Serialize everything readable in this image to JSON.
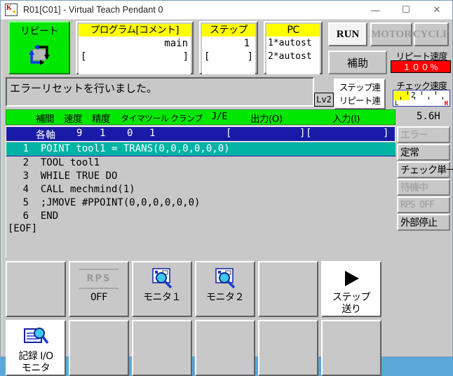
{
  "window": {
    "title": "R01[C01] - Virtual Teach Pendant 0",
    "app_icon": "kawasaki-robot-icon",
    "minimize": "—",
    "maximize": "☐",
    "close": "✕"
  },
  "mode_button": {
    "label": "リピート",
    "icon": "repeat-cycle-icon",
    "color": "#00e800"
  },
  "program_field": {
    "header": "プログラム[コメント]",
    "value": "main",
    "bracket_left": "[",
    "bracket_right": "]"
  },
  "step_field": {
    "header": "ステップ",
    "value": "1",
    "bracket_left": "[",
    "bracket_right": "]"
  },
  "pc_field": {
    "header": "PC",
    "line1": "1*autost",
    "line2": "2*autost"
  },
  "lamps": {
    "run": "RUN",
    "motor": "MOTOR",
    "cycle": "CYCLE"
  },
  "aux_button": {
    "label": "補助"
  },
  "repeat_speed": {
    "label": "リピート速度",
    "value": "１００％",
    "color": "#ff0000"
  },
  "message": {
    "text": "エラーリセットを行いました。",
    "level_badge": "Lv2"
  },
  "step_repeat_button": {
    "line1": "ステップ連",
    "line2": "リピート連"
  },
  "check_speed": {
    "label": "チェック速度",
    "value": "2",
    "min_label": "L",
    "max_label": "H"
  },
  "hz_label": "5.6H",
  "column_header": {
    "items": [
      "補間",
      "速度",
      "精度",
      "タイマ",
      "ツール",
      "クランプ",
      "J/E",
      "出力(O)",
      "入力(I)"
    ]
  },
  "status_row": {
    "axis": "各軸",
    "v1": "9",
    "v2": "1",
    "v3": "0",
    "v4": "1",
    "out_open": "[",
    "out_close": "]",
    "in_open": "[",
    "in_close": "]"
  },
  "code": {
    "lines": [
      {
        "no": "1",
        "text": "POINT tool1 = TRANS(0,0,0,0,0,0)",
        "selected": true
      },
      {
        "no": "2",
        "text": "TOOL tool1",
        "selected": false
      },
      {
        "no": "3",
        "text": "WHILE TRUE DO",
        "selected": false
      },
      {
        "no": "4",
        "text": "CALL mechmind(1)",
        "selected": false
      },
      {
        "no": "5",
        "text": ";JMOVE #PPOINT(0,0,0,0,0,0)",
        "selected": false
      },
      {
        "no": "6",
        "text": "END",
        "selected": false
      }
    ],
    "eof": "[EOF]"
  },
  "status_stack": [
    {
      "label": "エラー",
      "dim": true,
      "mono": false
    },
    {
      "label": "定常",
      "dim": false,
      "mono": false
    },
    {
      "label": "チェック単一",
      "dim": false,
      "mono": false
    },
    {
      "label": "待機中",
      "dim": true,
      "mono": false
    },
    {
      "label": "RPS OFF",
      "dim": true,
      "mono": true
    },
    {
      "label": "外部停止",
      "dim": false,
      "mono": false
    }
  ],
  "function_keys": {
    "row1": [
      {
        "name": "fkey-blank-1",
        "icon": "",
        "label": "",
        "sublabel": ""
      },
      {
        "name": "fkey-rps",
        "icon": "rps-off-icon",
        "label": "RPS",
        "sublabel": "OFF"
      },
      {
        "name": "fkey-monitor-1",
        "icon": "monitor-magnifier-icon",
        "label": "",
        "sublabel": "モニタ１"
      },
      {
        "name": "fkey-monitor-2",
        "icon": "monitor-magnifier-icon",
        "label": "",
        "sublabel": "モニタ２"
      },
      {
        "name": "fkey-blank-2",
        "icon": "",
        "label": "",
        "sublabel": ""
      },
      {
        "name": "fkey-step-forward",
        "icon": "play-triangle-icon",
        "label": "",
        "sublabel": "ステップ\n送り"
      }
    ],
    "row2": [
      {
        "name": "fkey-io-monitor",
        "icon": "document-magnifier-icon",
        "label": "記録 I/O",
        "sublabel": "モニタ"
      },
      {
        "name": "fkey-blank-3",
        "icon": "",
        "label": "",
        "sublabel": ""
      },
      {
        "name": "fkey-blank-4",
        "icon": "",
        "label": "",
        "sublabel": ""
      },
      {
        "name": "fkey-blank-5",
        "icon": "",
        "label": "",
        "sublabel": ""
      },
      {
        "name": "fkey-blank-6",
        "icon": "",
        "label": "",
        "sublabel": ""
      },
      {
        "name": "fkey-blank-7",
        "icon": "",
        "label": "",
        "sublabel": ""
      }
    ],
    "step_forward_line1": "ステップ",
    "step_forward_line2": "送り",
    "io_monitor_line1": "記録 I/O",
    "io_monitor_line2": "モニタ"
  }
}
